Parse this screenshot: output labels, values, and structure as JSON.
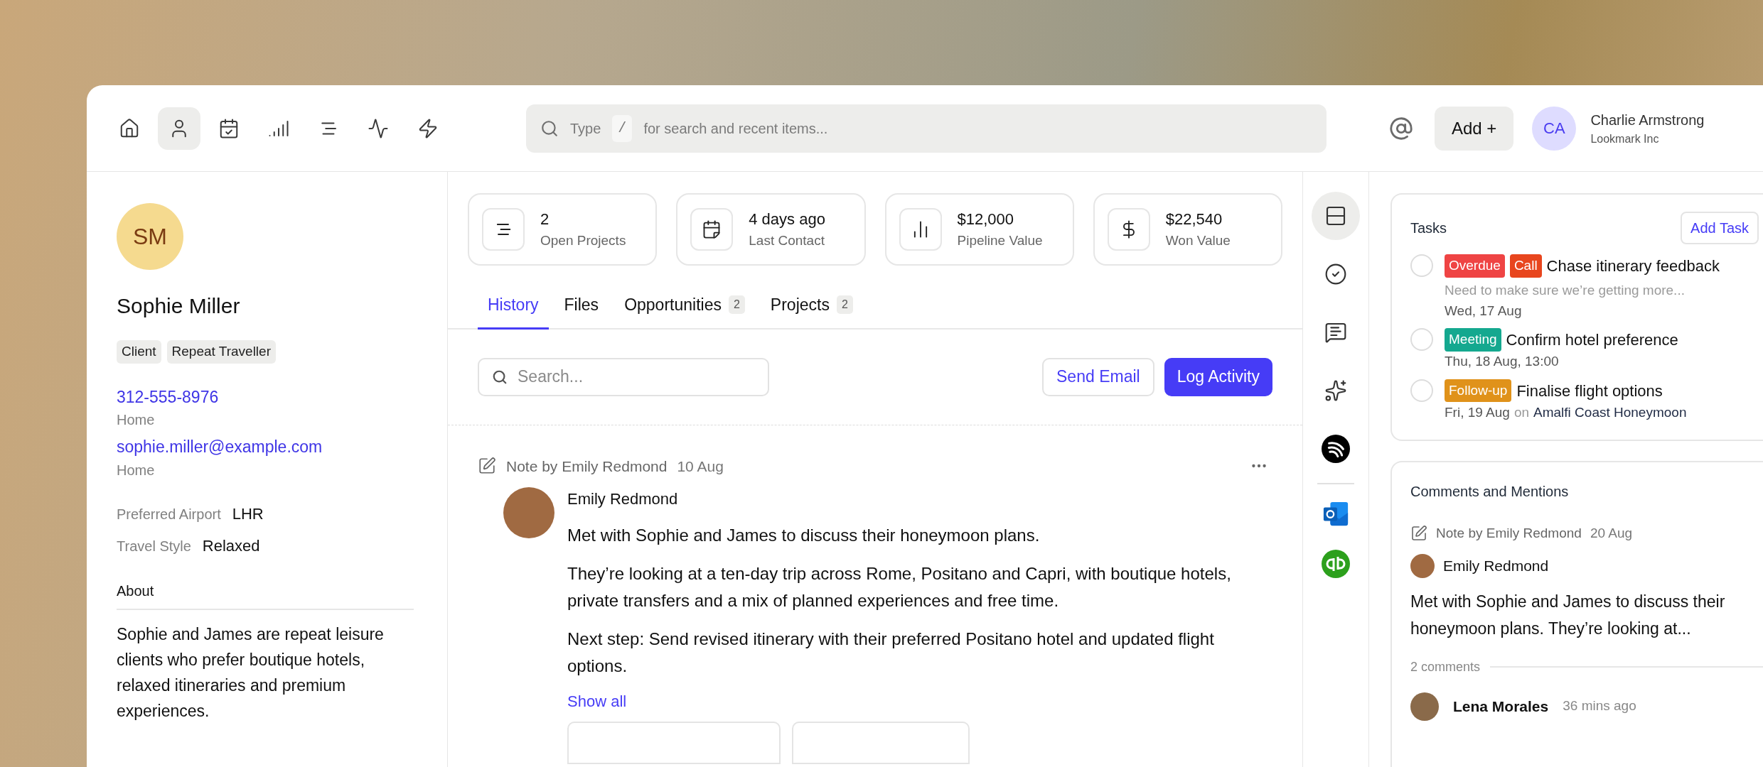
{
  "topbar": {
    "nav": [
      {
        "selected": false
      },
      {
        "selected": true
      },
      {
        "selected": false
      },
      {
        "selected": false
      },
      {
        "selected": false
      },
      {
        "selected": false
      },
      {
        "selected": false
      }
    ],
    "search": {
      "prefix": "Type",
      "shortcut": "/",
      "placeholder": "for search and recent items..."
    },
    "add_button": "Add +",
    "user": {
      "initials": "CA",
      "name": "Charlie Armstrong",
      "company": "Lookmark Inc"
    }
  },
  "contact": {
    "initials": "SM",
    "name": "Sophie Miller",
    "tags": [
      "Client",
      "Repeat Traveller"
    ],
    "contacts": [
      {
        "value": "312-555-8976",
        "label": "Home"
      },
      {
        "value": "sophie.miller@example.com",
        "label": "Home"
      }
    ],
    "fields": [
      {
        "label": "Preferred Airport",
        "value": "LHR"
      },
      {
        "label": "Travel Style",
        "value": "Relaxed"
      }
    ],
    "about": {
      "title": "About",
      "text": "Sophie and James are repeat leisure clients who prefer boutique hotels, relaxed itineraries and premium experiences."
    }
  },
  "stats": [
    {
      "value": "2",
      "label": "Open Projects"
    },
    {
      "value": "4 days ago",
      "label": "Last Contact"
    },
    {
      "value": "$12,000",
      "label": "Pipeline Value"
    },
    {
      "value": "$22,540",
      "label": "Won Value"
    }
  ],
  "tabs": [
    {
      "label": "History",
      "selected": true
    },
    {
      "label": "Files",
      "selected": false
    },
    {
      "label": "Opportunities",
      "count": "2",
      "selected": false
    },
    {
      "label": "Projects",
      "count": "2",
      "selected": false
    }
  ],
  "history": {
    "search": {
      "placeholder": "Search..."
    },
    "buttons": [
      "Send Email",
      "Log Activity"
    ],
    "note": {
      "title": "Note by Emily Redmond",
      "date": "10 Aug",
      "author": "Emily Redmond",
      "paragraphs": [
        "Met with Sophie and James to discuss their honeymoon plans.",
        "They’re looking at a ten-day trip across Rome, Positano and Capri, with boutique hotels, private transfers and a mix of planned experiences and free time.",
        "Next step: Send revised itinerary with their preferred Positano hotel and updated flight options."
      ],
      "show_all": "Show all"
    }
  },
  "rail": [
    {
      "selected": true
    },
    {
      "selected": false
    },
    {
      "selected": false
    },
    {
      "selected": false
    },
    {
      "selected": false
    }
  ],
  "tasks": {
    "title": "Tasks",
    "add_button": "Add Task",
    "items": [
      {
        "checked": false,
        "tags": [
          {
            "label": "Overdue",
            "color": "#ef4444"
          },
          {
            "label": "Call",
            "color": "#e8461e"
          }
        ],
        "title": "Chase itinerary feedback",
        "note": "Need to make sure we’re getting more...",
        "date": "Wed, 17 Aug"
      },
      {
        "checked": false,
        "tags": [
          {
            "label": "Meeting",
            "color": "#14a88f"
          }
        ],
        "title": "Confirm hotel preference",
        "date": "Thu, 18 Aug, 13:00"
      },
      {
        "checked": false,
        "tags": [
          {
            "label": "Follow-up",
            "color": "#e0921a"
          }
        ],
        "title": "Finalise flight options",
        "date": "Fri, 19 Aug",
        "connector": "on",
        "project": "Amalfi Coast Honeymoon"
      }
    ]
  },
  "comments": {
    "title": "Comments and Mentions",
    "note_title": "Note by Emily Redmond",
    "date": "20 Aug",
    "author": "Emily Redmond",
    "text": "Met with Sophie and James to discuss their honeymoon plans. They’re looking at...",
    "count": "2 comments",
    "reply": {
      "author": "Lena Morales",
      "time": "36 mins ago"
    }
  }
}
